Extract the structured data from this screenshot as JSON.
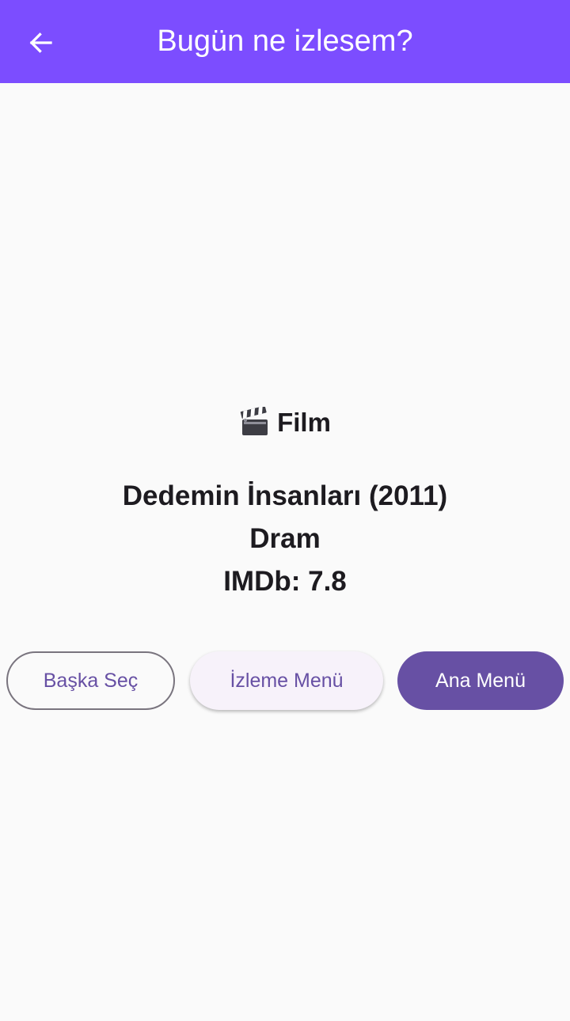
{
  "appbar": {
    "title": "Bugün ne izlesem?",
    "back_icon": "arrow-left-icon",
    "background_color": "#7c4dff"
  },
  "result": {
    "type_icon": "clapperboard-icon",
    "type_label": "Film",
    "title_line": "Dedemin İnsanları (2011)",
    "genre": "Dram",
    "rating_line": "IMDb: 7.8"
  },
  "actions": {
    "pick_another_label": "Başka Seç",
    "watch_menu_label": "İzleme Menü",
    "main_menu_label": "Ana Menü"
  },
  "colors": {
    "primary": "#6750a4",
    "background": "#fafafa"
  }
}
